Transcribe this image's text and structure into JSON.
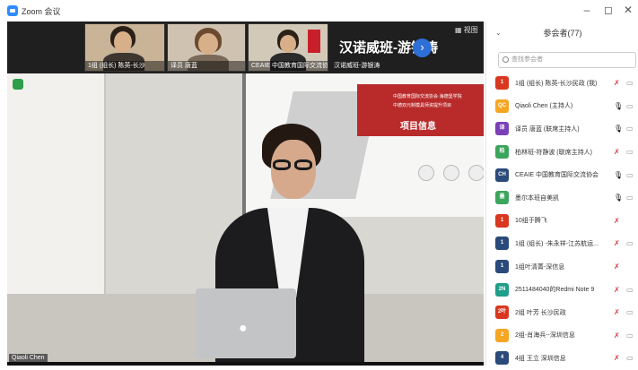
{
  "window": {
    "title": "Zoom 会议",
    "minimize": "–",
    "maximize": "◻",
    "close": "✕"
  },
  "strip": {
    "thumbs": [
      {
        "caption": "1组 (组长) 陈英-长沙",
        "bg": "#c9b497"
      },
      {
        "caption": "译员 唐蓝",
        "bg": "#cfc2b0"
      },
      {
        "caption": "CEAIE 中国教育国际交流协会",
        "bg": "#d3c9b9"
      },
      {
        "caption": "汉诺威班-游银涛",
        "bg": "#d8cfc4"
      }
    ],
    "big_name": "汉诺威班-游银涛",
    "view_label": "▦ 视图",
    "arrow": "›"
  },
  "slide": {
    "title": "项目信息",
    "sub1": "中国教育国际交流协会·海德堡学院",
    "sub2": "中德双元制模具师资提升项目"
  },
  "self_name": "Qiaoli Chen",
  "panel": {
    "title": "参会者(77)",
    "collapse": "⌄",
    "search_placeholder": "查找参会者",
    "participants": [
      {
        "avatar": "1",
        "color": "#d9371f",
        "name": "1组 (组长) 陈英-长沙民政 (我)",
        "mic": "✗",
        "mic_muted": true,
        "cam": "▭"
      },
      {
        "avatar": "QC",
        "color": "#f5a623",
        "name": "Qiaoli Chen (主持人)",
        "mic": "🎙",
        "mic_muted": false,
        "cam": "▭"
      },
      {
        "avatar": "译",
        "color": "#7b3fb8",
        "name": "译员 唐蓝 (联席主持人)",
        "mic": "🎙",
        "mic_muted": false,
        "cam": "▭"
      },
      {
        "avatar": "柏",
        "color": "#3ca55c",
        "name": "柏林班-符静波 (联席主持人)",
        "mic": "✗",
        "mic_muted": true,
        "cam": "▭"
      },
      {
        "avatar": "CH",
        "color": "#2a4a7a",
        "name": "CEAIE 中国教育国际交流协会",
        "mic": "🎙",
        "mic_muted": false,
        "cam": "▭"
      },
      {
        "avatar": "墨",
        "color": "#3ca55c",
        "name": "墨尔本班自美凯",
        "mic": "🎙",
        "mic_muted": false,
        "cam": "▭"
      },
      {
        "avatar": "1",
        "color": "#d9371f",
        "name": "10组于腾飞",
        "mic": "✗",
        "mic_muted": true,
        "cam": ""
      },
      {
        "avatar": "1",
        "color": "#2a4a7a",
        "name": "1组 (组长) -朱永祥-江苏航运...",
        "mic": "✗",
        "mic_muted": true,
        "cam": "▭"
      },
      {
        "avatar": "1",
        "color": "#2a4a7a",
        "name": "1组叶清菁-深信息",
        "mic": "✗",
        "mic_muted": true,
        "cam": ""
      },
      {
        "avatar": "2N",
        "color": "#1f9e8a",
        "name": "2511484040的Redmi Note 9",
        "mic": "✗",
        "mic_muted": true,
        "cam": "▭"
      },
      {
        "avatar": "2叶",
        "color": "#d9371f",
        "name": "2组 叶芳 长沙民政",
        "mic": "✗",
        "mic_muted": true,
        "cam": "▭"
      },
      {
        "avatar": "2",
        "color": "#f5a623",
        "name": "2组-肖海兵--深圳信息",
        "mic": "✗",
        "mic_muted": true,
        "cam": "▭"
      },
      {
        "avatar": "4",
        "color": "#2a4a7a",
        "name": "4组 王立 深圳信息",
        "mic": "✗",
        "mic_muted": true,
        "cam": "▭"
      }
    ]
  }
}
